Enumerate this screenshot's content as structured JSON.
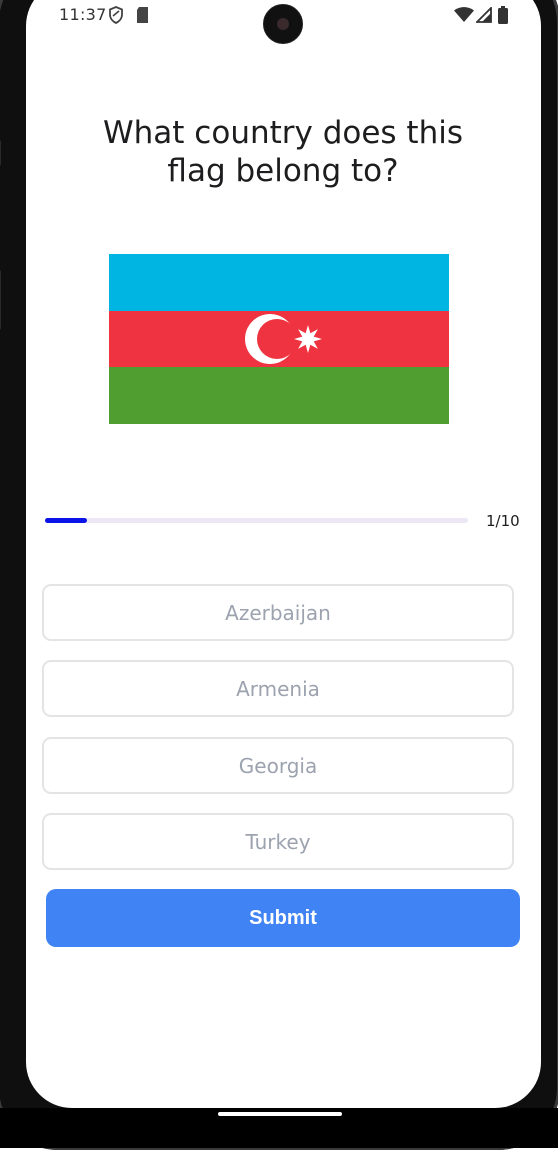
{
  "status_bar": {
    "time": "11:37",
    "icons_left": [
      "shield-icon",
      "sd-card-icon"
    ],
    "icons_right": [
      "wifi-icon",
      "signal-icon",
      "battery-icon"
    ]
  },
  "quiz": {
    "question_line1": "What country does this",
    "question_line2": "flag belong to?",
    "flag": {
      "name": "azerbaijan-flag",
      "colors": {
        "top": "#00b5e2",
        "middle": "#ef3340",
        "bottom": "#509e2f",
        "emblem": "#ffffff"
      }
    },
    "progress": {
      "current": 1,
      "total": 10,
      "label": "1/10",
      "fraction": 0.1
    },
    "options": [
      "Azerbaijan",
      "Armenia",
      "Georgia",
      "Turkey"
    ],
    "submit_label": "Submit"
  },
  "colors": {
    "accent": "#3f83f5",
    "progress_fill": "#0a14e6",
    "progress_track": "#ece6f5",
    "option_text": "#9ca3af",
    "option_border": "#e4e4e7"
  }
}
